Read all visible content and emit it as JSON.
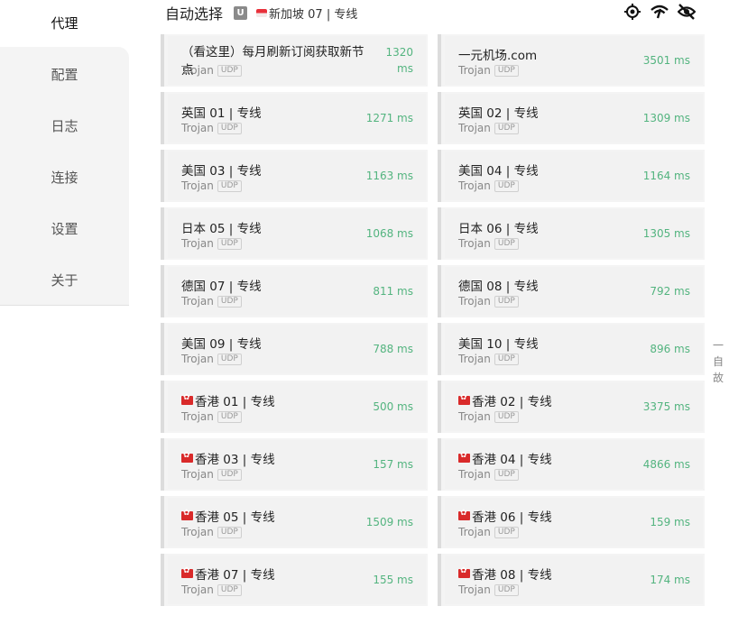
{
  "sidebar": {
    "items": [
      {
        "label": "代理",
        "active": true
      },
      {
        "label": "配置"
      },
      {
        "label": "日志"
      },
      {
        "label": "连接"
      },
      {
        "label": "设置"
      },
      {
        "label": "关于"
      }
    ]
  },
  "header": {
    "title": "自动选择",
    "badge": "U",
    "current": "新加坡 07 | 专线",
    "icons": [
      "locate-icon",
      "wifi-speed-icon",
      "eye-off-icon"
    ]
  },
  "nodes": [
    {
      "name": "（看这里）每月刷新订阅获取新节点",
      "type": "Trojan",
      "udp": "UDP",
      "delay": "1320 ms",
      "flag": ""
    },
    {
      "name": "一元机场.com",
      "type": "Trojan",
      "udp": "UDP",
      "delay": "3501 ms",
      "flag": ""
    },
    {
      "name": "英国 01 | 专线",
      "type": "Trojan",
      "udp": "UDP",
      "delay": "1271 ms",
      "flag": ""
    },
    {
      "name": "英国 02 | 专线",
      "type": "Trojan",
      "udp": "UDP",
      "delay": "1309 ms",
      "flag": ""
    },
    {
      "name": "美国 03 | 专线",
      "type": "Trojan",
      "udp": "UDP",
      "delay": "1163 ms",
      "flag": ""
    },
    {
      "name": "美国 04 | 专线",
      "type": "Trojan",
      "udp": "UDP",
      "delay": "1164 ms",
      "flag": ""
    },
    {
      "name": "日本 05 | 专线",
      "type": "Trojan",
      "udp": "UDP",
      "delay": "1068 ms",
      "flag": ""
    },
    {
      "name": "日本 06 | 专线",
      "type": "Trojan",
      "udp": "UDP",
      "delay": "1305 ms",
      "flag": ""
    },
    {
      "name": "德国 07 | 专线",
      "type": "Trojan",
      "udp": "UDP",
      "delay": "811 ms",
      "flag": ""
    },
    {
      "name": "德国 08 | 专线",
      "type": "Trojan",
      "udp": "UDP",
      "delay": "792 ms",
      "flag": ""
    },
    {
      "name": "美国 09 | 专线",
      "type": "Trojan",
      "udp": "UDP",
      "delay": "788 ms",
      "flag": ""
    },
    {
      "name": "美国 10 | 专线",
      "type": "Trojan",
      "udp": "UDP",
      "delay": "896 ms",
      "flag": ""
    },
    {
      "name": "香港 01 | 专线",
      "type": "Trojan",
      "udp": "UDP",
      "delay": "500 ms",
      "flag": "hk"
    },
    {
      "name": "香港 02 | 专线",
      "type": "Trojan",
      "udp": "UDP",
      "delay": "3375 ms",
      "flag": "hk"
    },
    {
      "name": "香港 03 | 专线",
      "type": "Trojan",
      "udp": "UDP",
      "delay": "157 ms",
      "flag": "hk"
    },
    {
      "name": "香港 04 | 专线",
      "type": "Trojan",
      "udp": "UDP",
      "delay": "4866 ms",
      "flag": "hk"
    },
    {
      "name": "香港 05 | 专线",
      "type": "Trojan",
      "udp": "UDP",
      "delay": "1509 ms",
      "flag": "hk"
    },
    {
      "name": "香港 06 | 专线",
      "type": "Trojan",
      "udp": "UDP",
      "delay": "159 ms",
      "flag": "hk"
    },
    {
      "name": "香港 07 | 专线",
      "type": "Trojan",
      "udp": "UDP",
      "delay": "155 ms",
      "flag": "hk"
    },
    {
      "name": "香港 08 | 专线",
      "type": "Trojan",
      "udp": "UDP",
      "delay": "174 ms",
      "flag": "hk"
    }
  ],
  "right_edge_text": "一 自 故",
  "colors": {
    "delay": "#53b47f",
    "accent_card": "#f4f4f4"
  }
}
